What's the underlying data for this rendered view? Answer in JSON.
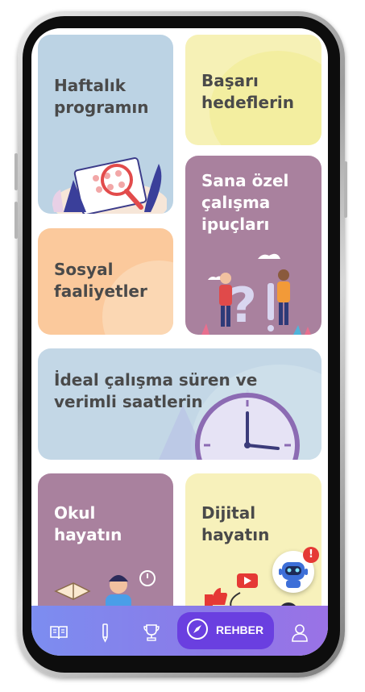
{
  "cards": {
    "weekly": "Haftalık\nprogramın",
    "goals": "Başarı\nhedeflerin",
    "tips": "Sana özel\nçalışma\nipuçları",
    "social": "Sosyal\nfaaliyetler",
    "ideal": "İdeal çalışma süren ve\nverimli saatlerin",
    "school": "Okul\nhayatın",
    "digital": "Dijital\nhayatın"
  },
  "nav": {
    "items": [
      "book-icon",
      "pencil-icon",
      "trophy-icon",
      "compass-icon",
      "user-icon"
    ],
    "rehber_label": "REHBER"
  },
  "assistant": {
    "badge": "!"
  },
  "colors": {
    "weekly_bg": "#bcd3e4",
    "goals_bg": "#f6f1b6",
    "tips_bg": "#a9819e",
    "social_bg": "#fbc99c",
    "ideal_bg": "#c3d7e6",
    "school_bg": "#a9819e",
    "digital_bg": "#f7f1bb",
    "nav_accent": "#6a3fe0"
  }
}
